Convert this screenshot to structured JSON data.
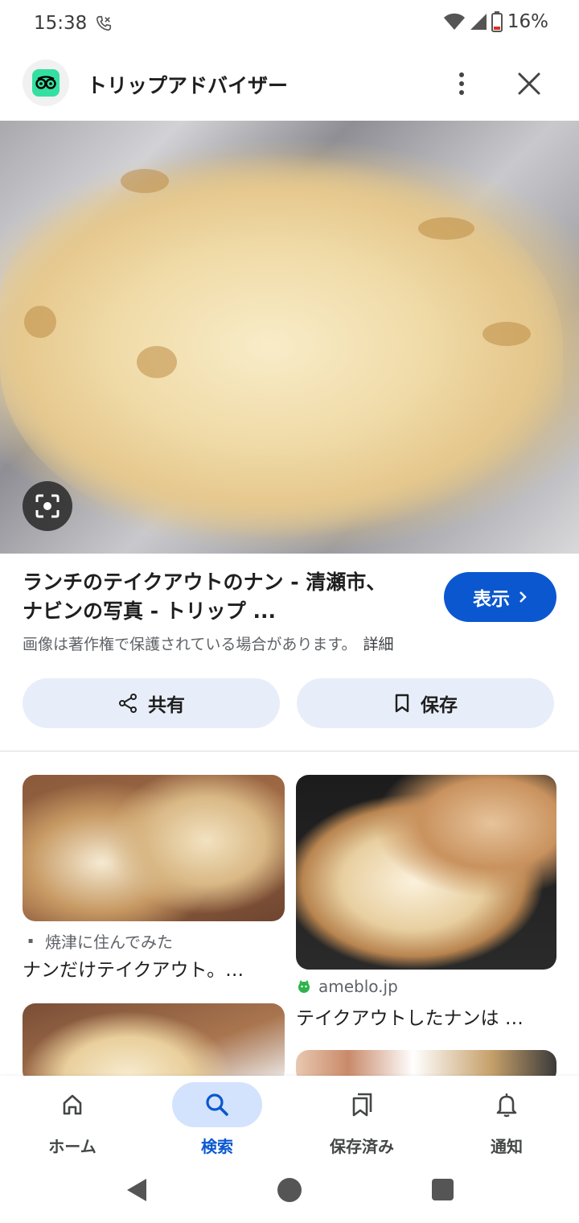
{
  "status_bar": {
    "time": "15:38",
    "battery_percent": "16%",
    "icons": [
      "call-forward-icon",
      "wifi-icon",
      "signal-icon",
      "battery-low-icon"
    ]
  },
  "header": {
    "app_title": "トリップアドバイザー",
    "icons": [
      "tripadvisor-logo-icon",
      "more-vert-icon",
      "close-icon"
    ]
  },
  "result": {
    "title": "ランチのテイクアウトのナン - 清瀬市、ナビンの写真 - トリップ ...",
    "visit_label": "表示",
    "copyright_note": "画像は著作権で保護されている場合があります。",
    "details_label": "詳細",
    "share_label": "共有",
    "save_label": "保存"
  },
  "related": [
    {
      "source": "焼津に住んでみた",
      "caption": "ナンだけテイクアウト。…"
    },
    {
      "source": "ameblo.jp",
      "caption": "テイクアウトしたナンは …"
    }
  ],
  "bottom_nav": {
    "items": [
      {
        "label": "ホーム",
        "icon": "home-icon",
        "active": false
      },
      {
        "label": "検索",
        "icon": "search-icon",
        "active": true
      },
      {
        "label": "保存済み",
        "icon": "saved-collections-icon",
        "active": false
      },
      {
        "label": "通知",
        "icon": "bell-icon",
        "active": false
      }
    ]
  },
  "colors": {
    "accent": "#0b57d0",
    "chip_bg": "#e8eef9",
    "active_nav_bg": "#d3e3fd",
    "tripadvisor_green": "#34e0a1"
  }
}
